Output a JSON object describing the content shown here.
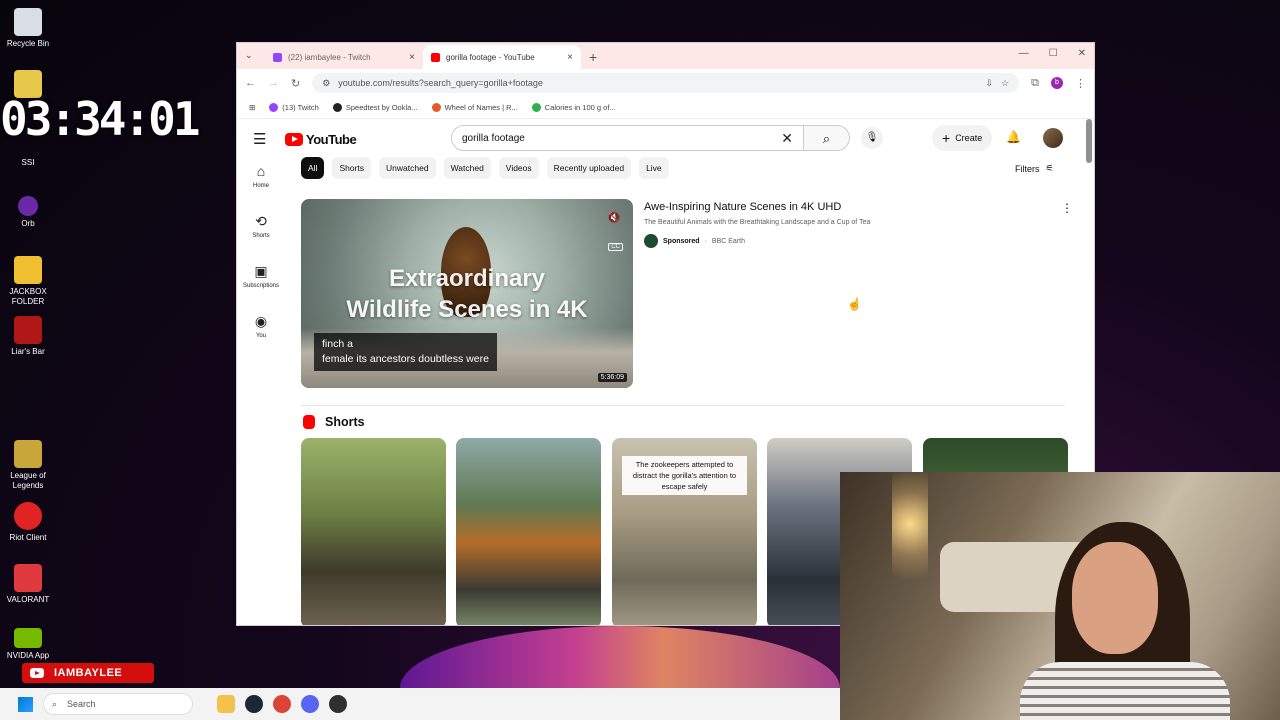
{
  "desktop": {
    "icons": [
      {
        "label": "Recycle Bin",
        "color": "#d8dde6"
      },
      {
        "label": "SSI",
        "color": "#e8c84a"
      },
      {
        "label": "Orb",
        "color": "#6a2aa8"
      },
      {
        "label": "JACKBOX FOLDER",
        "color": "#f0c030"
      },
      {
        "label": "Liar's Bar",
        "color": "#b01818"
      },
      {
        "label": "League of Legends",
        "color": "#c9a63a"
      },
      {
        "label": "Riot Client",
        "color": "#e02424"
      },
      {
        "label": "VALORANT",
        "color": "#e0393e"
      },
      {
        "label": "NVIDIA App",
        "color": "#76b900"
      }
    ],
    "timer": "03:34:01"
  },
  "browser": {
    "tabs": [
      {
        "title": "(22) iambaylee - Twitch",
        "color": "#9146ff",
        "active": false
      },
      {
        "title": "gorilla footage - YouTube",
        "color": "#ff0000",
        "active": true
      }
    ],
    "new_tab": "+",
    "url": "youtube.com/results?search_query=gorilla+footage",
    "profile_initial": "b",
    "bookmarks": [
      {
        "label": "(13) Twitch",
        "color": "#9146ff"
      },
      {
        "label": "Speedtest by Ookla...",
        "color": "#222"
      },
      {
        "label": "Wheel of Names | R...",
        "color": "#e65a2a"
      },
      {
        "label": "Calories in 100 g of...",
        "color": "#2bb24c"
      }
    ]
  },
  "youtube": {
    "logo_text": "YouTube",
    "search_query": "gorilla footage",
    "create_label": "Create",
    "nav": [
      {
        "label": "Home",
        "icon": "home-icon",
        "glyph": "⌂"
      },
      {
        "label": "Shorts",
        "icon": "shorts-icon",
        "glyph": "⟲"
      },
      {
        "label": "Subscriptions",
        "icon": "subscriptions-icon",
        "glyph": "▣"
      },
      {
        "label": "You",
        "icon": "you-icon",
        "glyph": "◉"
      }
    ],
    "chips": [
      "All",
      "Shorts",
      "Unwatched",
      "Watched",
      "Videos",
      "Recently uploaded",
      "Live"
    ],
    "filters_label": "Filters",
    "ad": {
      "title": "Awe-Inspiring Nature Scenes in 4K UHD",
      "description": "The Beautiful Animals with the Breathtaking Landscape and a Cup of Tea",
      "sponsored": "Sponsored",
      "channel": "BBC Earth",
      "thumb_line1": "Extraordinary",
      "thumb_line2": "Wildlife Scenes in 4K",
      "caption_line1": "finch a",
      "caption_line2": "female its ancestors doubtless were",
      "duration": "5:36:09",
      "cc": "CC"
    },
    "shorts_title": "Shorts",
    "short_caption": "The zookeepers attempted to distract the gorilla's attention to escape safely"
  },
  "overlay": {
    "channel_badge": "IAMBAYLEE"
  },
  "taskbar": {
    "search_placeholder": "Search",
    "apps": [
      {
        "name": "file-explorer-icon",
        "color": "#f2c14e"
      },
      {
        "name": "steam-icon",
        "color": "#1b2838"
      },
      {
        "name": "chrome-icon",
        "color": "#db4437"
      },
      {
        "name": "discord-icon",
        "color": "#5865f2"
      },
      {
        "name": "obs-icon",
        "color": "#302e31"
      }
    ]
  }
}
